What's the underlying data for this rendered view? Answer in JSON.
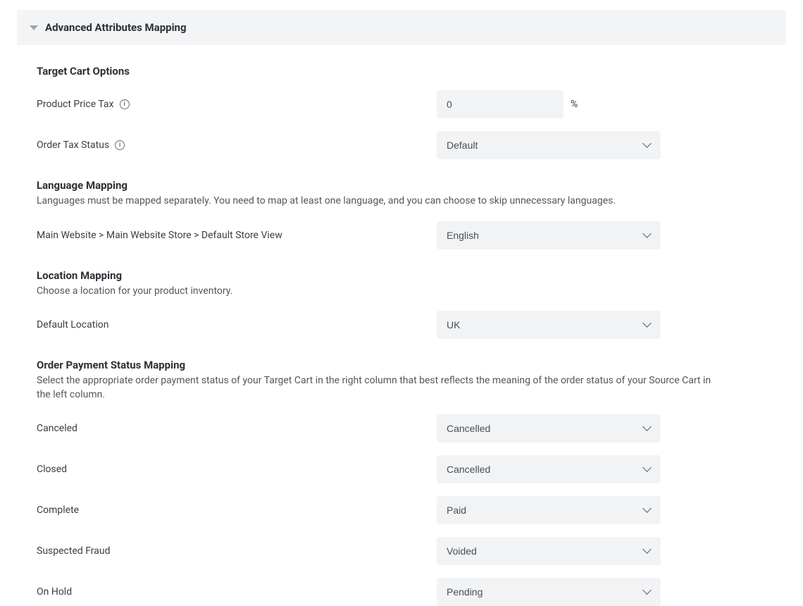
{
  "panel": {
    "title": "Advanced Attributes Mapping"
  },
  "sections": {
    "target_cart": {
      "title": "Target Cart Options",
      "rows": {
        "product_price_tax": {
          "label": "Product Price Tax",
          "value": "0",
          "suffix": "%"
        },
        "order_tax_status": {
          "label": "Order Tax Status",
          "value": "Default"
        }
      }
    },
    "language_mapping": {
      "title": "Language Mapping",
      "description": "Languages must be mapped separately. You need to map at least one language, and you can choose to skip unnecessary languages.",
      "rows": {
        "store_view": {
          "label": "Main Website > Main Website Store > Default Store View",
          "value": "English"
        }
      }
    },
    "location_mapping": {
      "title": "Location Mapping",
      "description": "Choose a location for your product inventory.",
      "rows": {
        "default_location": {
          "label": "Default Location",
          "value": "UK"
        }
      }
    },
    "payment_status": {
      "title": "Order Payment Status Mapping",
      "description": "Select the appropriate order payment status of your Target Cart in the right column that best reflects the meaning of the order status of your Source Cart in the left column.",
      "rows": {
        "canceled": {
          "label": "Canceled",
          "value": "Cancelled"
        },
        "closed": {
          "label": "Closed",
          "value": "Cancelled"
        },
        "complete": {
          "label": "Complete",
          "value": "Paid"
        },
        "suspected_fraud": {
          "label": "Suspected Fraud",
          "value": "Voided"
        },
        "on_hold": {
          "label": "On Hold",
          "value": "Pending"
        }
      }
    }
  }
}
